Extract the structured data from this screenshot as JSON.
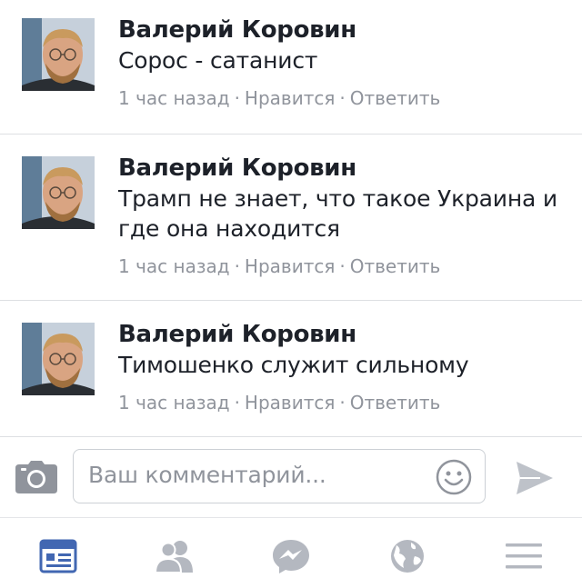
{
  "comments": [
    {
      "author": "Валерий Коровин",
      "text": "Сорос - сатанист",
      "time": "1 час назад",
      "like": "Нравится",
      "reply": "Ответить"
    },
    {
      "author": "Валерий Коровин",
      "text": "Трамп не знает, что такое Украина и где она находится",
      "time": "1 час назад",
      "like": "Нравится",
      "reply": "Ответить"
    },
    {
      "author": "Валерий Коровин",
      "text": "Тимошенко служит сильному",
      "time": "1 час назад",
      "like": "Нравится",
      "reply": "Ответить"
    }
  ],
  "meta_separator": "·",
  "composer": {
    "placeholder": "Ваш комментарий...",
    "camera_icon": "camera-icon",
    "emoji_icon": "smiley-icon",
    "send_icon": "send-icon"
  },
  "tabbar": {
    "items": [
      {
        "icon": "news-feed-icon",
        "active": true
      },
      {
        "icon": "friends-icon",
        "active": false
      },
      {
        "icon": "messenger-icon",
        "active": false
      },
      {
        "icon": "globe-icon",
        "active": false
      },
      {
        "icon": "menu-icon",
        "active": false
      }
    ],
    "active_color": "#4267b2",
    "inactive_color": "#b4b8c0"
  },
  "colors": {
    "text": "#1d2129",
    "meta": "#90949c",
    "divider": "#dddfe2"
  }
}
